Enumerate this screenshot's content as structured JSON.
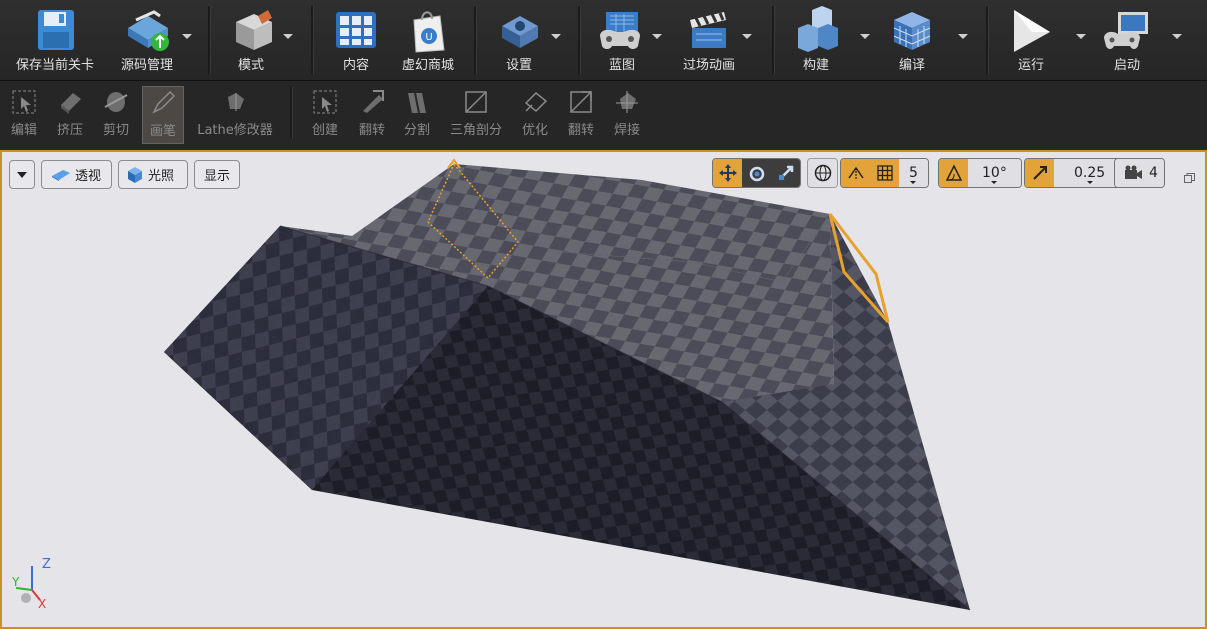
{
  "main_toolbar": {
    "save_current_level": "保存当前关卡",
    "source_control": "源码管理",
    "modes": "模式",
    "content": "内容",
    "marketplace": "虚幻商城",
    "settings": "设置",
    "blueprints": "蓝图",
    "cinematics": "过场动画",
    "build": "构建",
    "compile": "编译",
    "play": "运行",
    "launch": "启动"
  },
  "mode_toolbar": {
    "edit": "编辑",
    "extrude": "挤压",
    "clip": "剪切",
    "pen": "画笔",
    "lathe": "Lathe修改器",
    "create": "创建",
    "flip": "翻转",
    "split": "分割",
    "triangulate": "三角剖分",
    "optimize": "优化",
    "turn": "翻转",
    "weld": "焊接"
  },
  "viewport": {
    "perspective": "透视",
    "lit": "光照",
    "show": "显示",
    "grid_snap_value": "5",
    "rotation_snap_value": "10°",
    "scale_snap_value": "0.25",
    "camera_speed_value": "4",
    "axis_labels": {
      "z": "Z",
      "y": "Y",
      "x": "X"
    }
  },
  "colors": {
    "toolbar_bg": "#262626",
    "viewport_bg": "#e4e4e9",
    "selection_orange": "#e8a12c",
    "viewport_border": "#c3922c"
  }
}
